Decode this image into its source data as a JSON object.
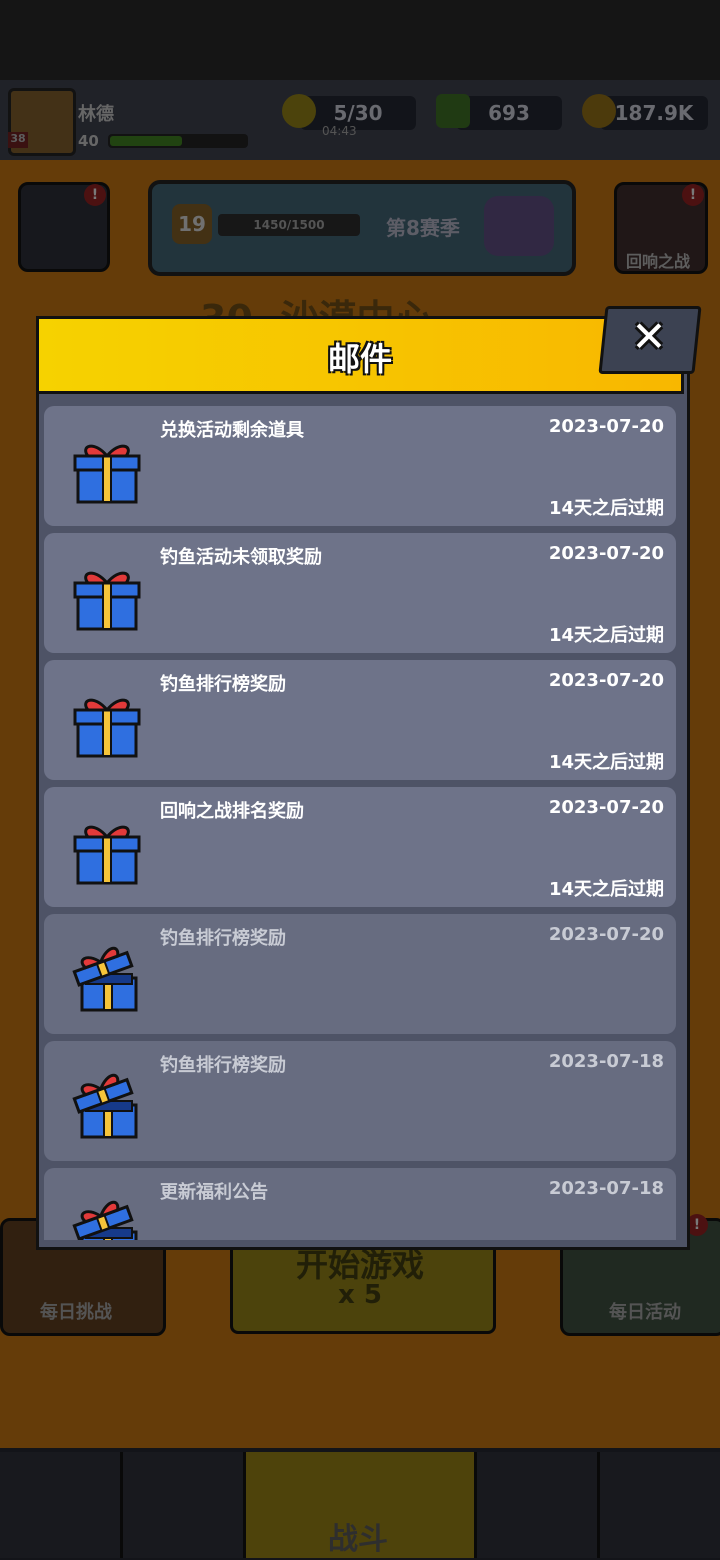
{
  "hud": {
    "player_name": "林德",
    "player_level": "40",
    "avatar_badge": "38",
    "energy": "5/30",
    "energy_timer": "04:43",
    "gems": "693",
    "coins": "187.9K"
  },
  "season": {
    "level": "19",
    "progress_text": "1450/1500",
    "label": "第8赛季"
  },
  "buttons": {
    "echo_battle": "回响之战",
    "daily_challenge": "每日挑战",
    "start_game": "开始游戏",
    "start_cost": "x 5",
    "daily_event": "每日活动",
    "fight": "战斗",
    "background_title": "30. 沙漠中心"
  },
  "modal": {
    "title": "邮件",
    "close": "✕"
  },
  "mails": [
    {
      "title": "兑换活动剩余道具",
      "date": "2023-07-20",
      "expire": "14天之后过期",
      "read": false
    },
    {
      "title": "钓鱼活动未领取奖励",
      "date": "2023-07-20",
      "expire": "14天之后过期",
      "read": false
    },
    {
      "title": "钓鱼排行榜奖励",
      "date": "2023-07-20",
      "expire": "14天之后过期",
      "read": false
    },
    {
      "title": "回响之战排名奖励",
      "date": "2023-07-20",
      "expire": "14天之后过期",
      "read": false
    },
    {
      "title": "钓鱼排行榜奖励",
      "date": "2023-07-20",
      "expire": "",
      "read": true
    },
    {
      "title": "钓鱼排行榜奖励",
      "date": "2023-07-18",
      "expire": "",
      "read": true
    },
    {
      "title": "更新福利公告",
      "date": "2023-07-18",
      "expire": "",
      "read": true
    }
  ],
  "colors": {
    "header_yellow": "#f6d200",
    "gift_blue": "#2f6fe0",
    "gift_ribbon": "#e23a3a"
  }
}
